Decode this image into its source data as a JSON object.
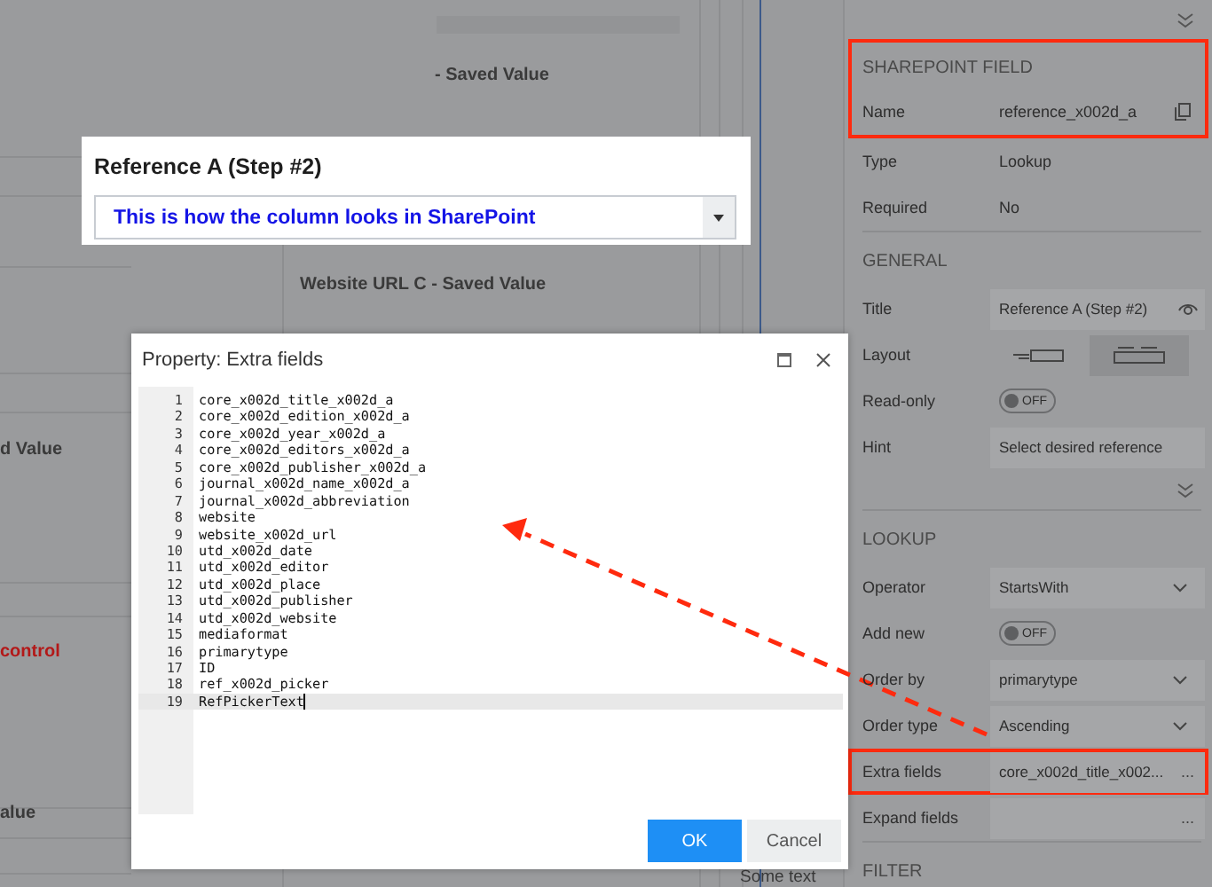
{
  "canvas": {
    "labels": [
      {
        "text": "- Saved Value",
        "kind": "label"
      },
      {
        "text": "Website URL C - Saved Value",
        "kind": "label"
      },
      {
        "text": "d Value",
        "kind": "label"
      },
      {
        "text": "control",
        "kind": "error"
      },
      {
        "text": "alue",
        "kind": "label"
      },
      {
        "text": "Some text",
        "kind": "plain"
      }
    ]
  },
  "popup": {
    "title": "Reference A (Step #2)",
    "value": "This is how the column looks in SharePoint"
  },
  "properties": {
    "sections": [
      {
        "title": "SHAREPOINT FIELD",
        "collapse_toggle": true,
        "highlighted": true,
        "rows": [
          {
            "label": "Name",
            "kind": "copy",
            "value": "reference_x002d_a"
          },
          {
            "label": "Type",
            "kind": "text",
            "value": "Lookup"
          },
          {
            "label": "Required",
            "kind": "text",
            "value": "No"
          }
        ]
      },
      {
        "title": "GENERAL",
        "collapse_toggle": false,
        "highlighted": false,
        "rows": [
          {
            "label": "Title",
            "kind": "eye-field",
            "value": "Reference A (Step #2)"
          },
          {
            "label": "Layout",
            "kind": "layout",
            "options": [
              {
                "selected": false
              },
              {
                "selected": true
              }
            ]
          },
          {
            "label": "Read-only",
            "kind": "toggle",
            "on": false,
            "state_label": "OFF"
          },
          {
            "label": "Hint",
            "kind": "field",
            "value": "Select desired reference"
          }
        ]
      },
      {
        "title": "LOOKUP",
        "collapse_toggle": true,
        "highlighted": false,
        "rows": [
          {
            "label": "Operator",
            "kind": "dropdown",
            "value": "StartsWith"
          },
          {
            "label": "Add new",
            "kind": "toggle",
            "on": false,
            "state_label": "OFF"
          },
          {
            "label": "Order by",
            "kind": "dropdown",
            "value": "primarytype"
          },
          {
            "label": "Order type",
            "kind": "dropdown",
            "value": "Ascending"
          },
          {
            "label": "Extra fields",
            "kind": "ellipsis-field",
            "value": "core_x002d_title_x002...",
            "button": "...",
            "highlighted": true
          },
          {
            "label": "Expand fields",
            "kind": "ellipsis-field",
            "button": "...",
            "highlighted": false
          }
        ]
      },
      {
        "title": "FILTER",
        "collapse_toggle": false,
        "highlighted": false
      }
    ]
  },
  "dialog": {
    "title": "Property: Extra fields",
    "lines": [
      {
        "number": "1",
        "text": "core_x002d_title_x002d_a",
        "current": false
      },
      {
        "number": "2",
        "text": "core_x002d_edition_x002d_a",
        "current": false
      },
      {
        "number": "3",
        "text": "core_x002d_year_x002d_a",
        "current": false
      },
      {
        "number": "4",
        "text": "core_x002d_editors_x002d_a",
        "current": false
      },
      {
        "number": "5",
        "text": "core_x002d_publisher_x002d_a",
        "current": false
      },
      {
        "number": "6",
        "text": "journal_x002d_name_x002d_a",
        "current": false
      },
      {
        "number": "7",
        "text": "journal_x002d_abbreviation",
        "current": false
      },
      {
        "number": "8",
        "text": "website",
        "current": false
      },
      {
        "number": "9",
        "text": "website_x002d_url",
        "current": false
      },
      {
        "number": "10",
        "text": "utd_x002d_date",
        "current": false
      },
      {
        "number": "11",
        "text": "utd_x002d_editor",
        "current": false
      },
      {
        "number": "12",
        "text": "utd_x002d_place",
        "current": false
      },
      {
        "number": "13",
        "text": "utd_x002d_publisher",
        "current": false
      },
      {
        "number": "14",
        "text": "utd_x002d_website",
        "current": false
      },
      {
        "number": "15",
        "text": "mediaformat",
        "current": false
      },
      {
        "number": "16",
        "text": "primarytype",
        "current": false
      },
      {
        "number": "17",
        "text": "ID",
        "current": false
      },
      {
        "number": "18",
        "text": "ref_x002d_picker",
        "current": false
      },
      {
        "number": "19",
        "text": "RefPickerText",
        "current": true
      }
    ],
    "buttons": [
      {
        "label": "OK",
        "kind": "primary"
      },
      {
        "label": "Cancel",
        "kind": "secondary"
      }
    ]
  }
}
